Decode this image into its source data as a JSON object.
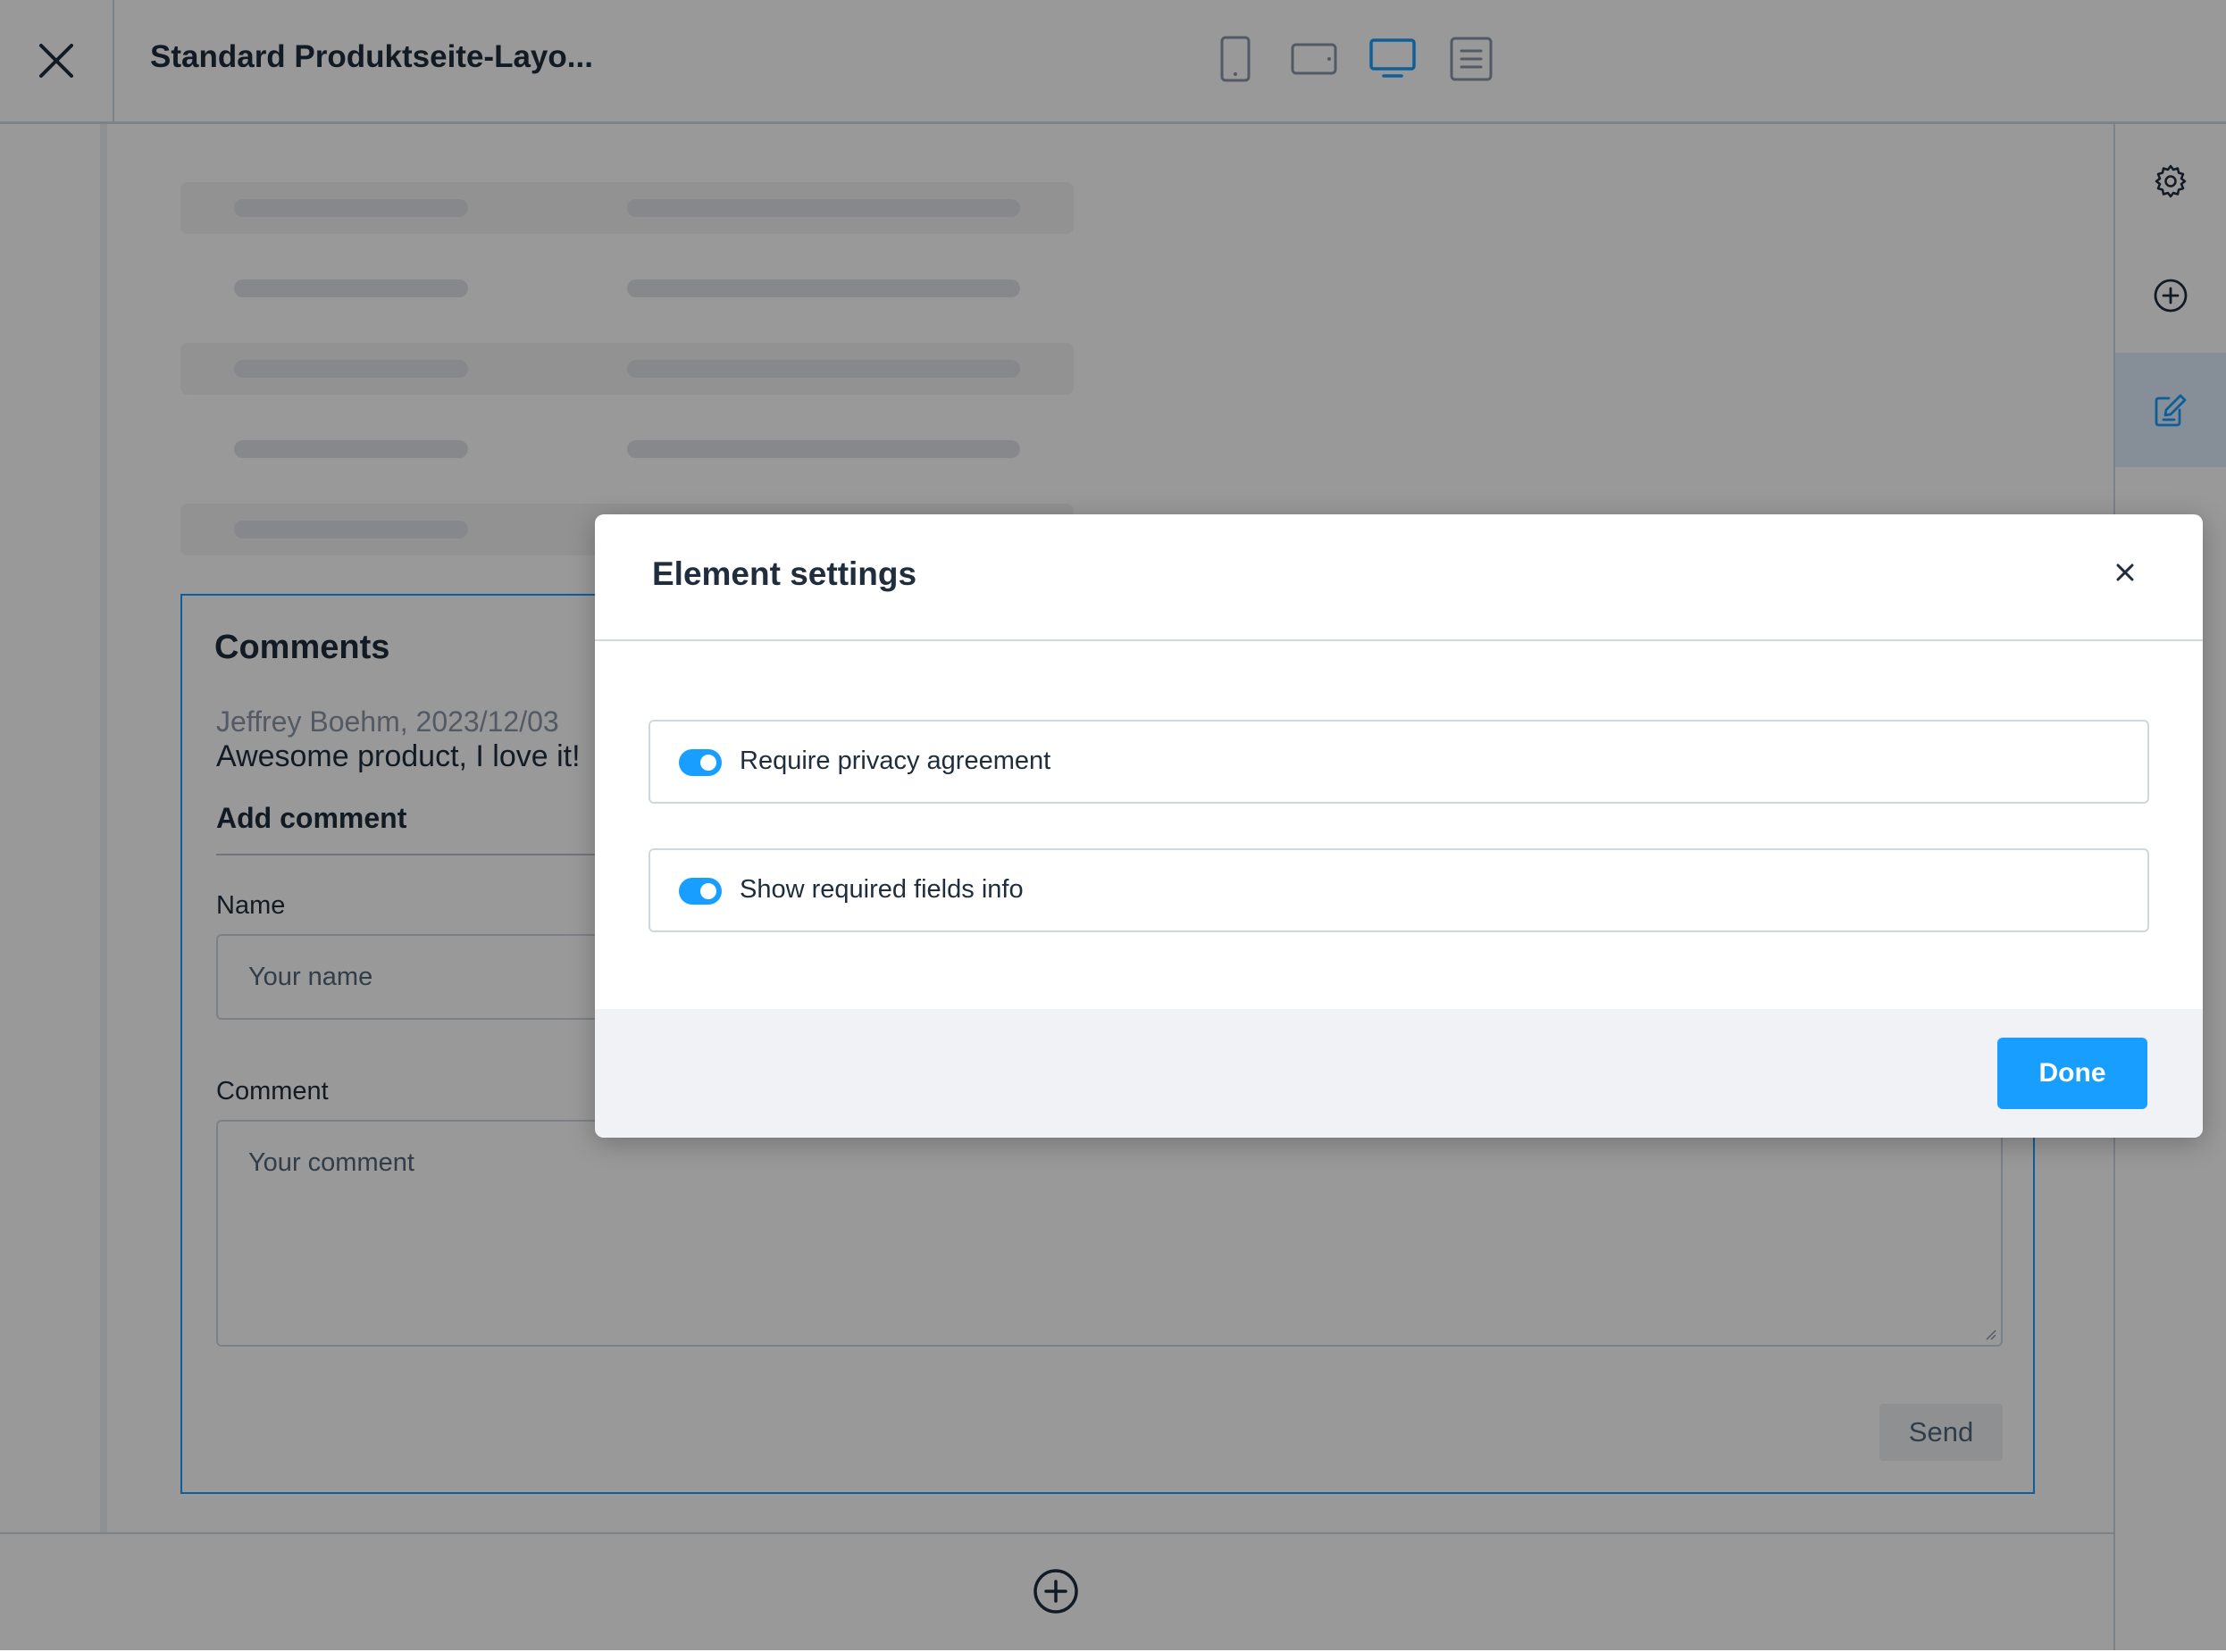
{
  "app": {
    "title": "Standard Produktseite-Layo...",
    "close_icon": "close-icon",
    "viewports": [
      {
        "name": "mobile",
        "icon": "phone-icon",
        "active": false
      },
      {
        "name": "tablet",
        "icon": "tablet-icon",
        "active": false
      },
      {
        "name": "desktop",
        "icon": "desktop-icon",
        "active": true
      },
      {
        "name": "list",
        "icon": "list-icon",
        "active": false
      }
    ]
  },
  "sidebar": {
    "items": [
      {
        "name": "settings",
        "icon": "gear-icon",
        "active": false
      },
      {
        "name": "add-block",
        "icon": "plus-circle-icon",
        "active": false
      },
      {
        "name": "edit",
        "icon": "edit-icon",
        "active": true
      }
    ]
  },
  "canvas": {
    "comments": {
      "title": "Comments",
      "entry_meta": "Jeffrey Boehm, 2023/12/03",
      "entry_text": "Awesome product, I love it!",
      "add_title": "Add comment",
      "name_label": "Name",
      "name_placeholder": "Your name",
      "comment_label": "Comment",
      "comment_placeholder": "Your comment",
      "send_label": "Send"
    },
    "add_section_icon": "plus-circle-icon"
  },
  "modal": {
    "title": "Element settings",
    "close_icon": "close-icon",
    "options": [
      {
        "label": "Require privacy agreement",
        "enabled": true
      },
      {
        "label": "Show required fields info",
        "enabled": true
      }
    ],
    "done_label": "Done"
  },
  "colors": {
    "accent": "#189eff",
    "text": "#1f2d3d",
    "muted": "#52667a",
    "border": "#d1d9e0",
    "active_bg": "#e0effc",
    "overlay": "rgba(0,0,0,0.4)"
  }
}
